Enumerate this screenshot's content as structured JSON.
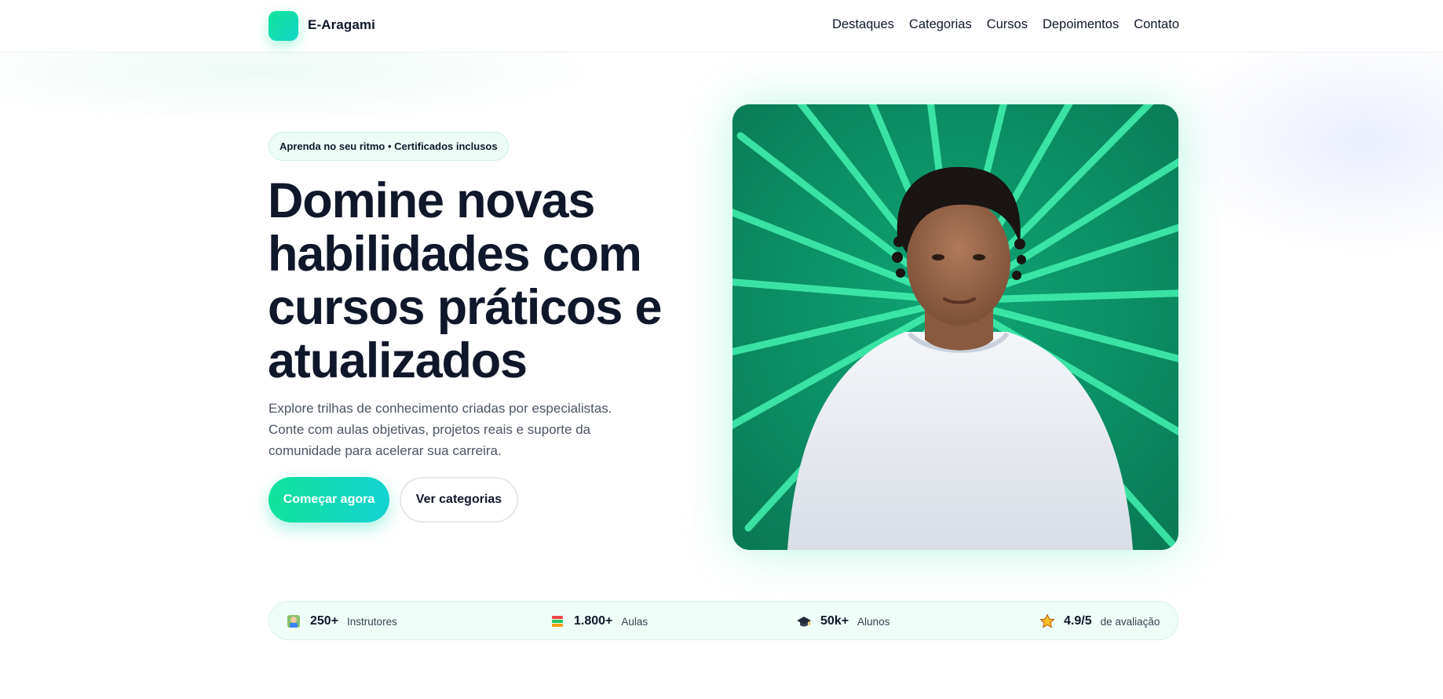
{
  "brand": {
    "name": "E-Aragami",
    "accent": "#10e39a",
    "accent_2": "#14d2d2"
  },
  "nav": {
    "items": [
      {
        "label": "Destaques"
      },
      {
        "label": "Categorias"
      },
      {
        "label": "Cursos"
      },
      {
        "label": "Depoimentos"
      },
      {
        "label": "Contato"
      }
    ]
  },
  "hero": {
    "badge": "Aprenda no seu ritmo • Certificados inclusos",
    "title": "Domine novas habilidades com cursos práticos e atualizados",
    "description": "Explore trilhas de conhecimento criadas por especialistas. Conte com aulas objetivas, projetos reais e suporte da comunidade para acelerar sua carreira.",
    "primary_cta": "Começar agora",
    "secondary_cta": "Ver categorias",
    "image": {
      "subject": "young man in white sweatshirt in front of green neon light rays"
    }
  },
  "stats": [
    {
      "icon": "instructor-icon",
      "value": "250+",
      "label": "Instrutores"
    },
    {
      "icon": "books-icon",
      "value": "1.800+",
      "label": "Aulas"
    },
    {
      "icon": "graduation-cap-icon",
      "value": "50k+",
      "label": "Alunos"
    },
    {
      "icon": "star-icon",
      "value": "4.9/5",
      "label": "de avaliação"
    }
  ]
}
